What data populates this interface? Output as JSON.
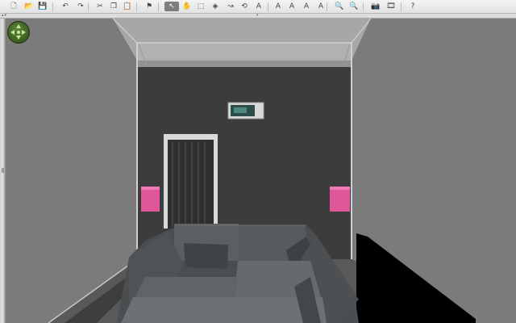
{
  "app": {
    "toolbar": [
      {
        "name": "new-file-icon",
        "glyph": "🗋"
      },
      {
        "name": "open-folder-icon",
        "glyph": "📂"
      },
      {
        "name": "save-icon",
        "glyph": "💾"
      },
      {
        "name": "undo-icon",
        "glyph": "↶"
      },
      {
        "name": "redo-icon",
        "glyph": "↷"
      },
      {
        "name": "cut-icon",
        "glyph": "✂"
      },
      {
        "name": "copy-icon",
        "glyph": "❐"
      },
      {
        "name": "paste-icon",
        "glyph": "📋"
      },
      {
        "name": "add-furniture-icon",
        "glyph": "⚑"
      },
      {
        "name": "select-mode-icon",
        "glyph": "↖",
        "active": true
      },
      {
        "name": "pan-mode-icon",
        "glyph": "✋"
      },
      {
        "name": "create-walls-icon",
        "glyph": "⬚"
      },
      {
        "name": "create-rooms-icon",
        "glyph": "◈"
      },
      {
        "name": "create-polylines-icon",
        "glyph": "↝"
      },
      {
        "name": "create-dimensions-icon",
        "glyph": "⟲"
      },
      {
        "name": "add-text-icon",
        "glyph": "A"
      },
      {
        "name": "increase-text-size-icon",
        "glyph": "A"
      },
      {
        "name": "decrease-text-size-icon",
        "glyph": "A"
      },
      {
        "name": "bold-text-icon",
        "glyph": "A"
      },
      {
        "name": "italic-text-icon",
        "glyph": "A"
      },
      {
        "name": "zoom-in-icon",
        "glyph": "🔍"
      },
      {
        "name": "zoom-out-icon",
        "glyph": "🔍"
      },
      {
        "name": "create-photo-icon",
        "glyph": "📷"
      },
      {
        "name": "create-video-icon",
        "glyph": "🎞"
      },
      {
        "name": "help-icon",
        "glyph": "?"
      }
    ],
    "colors": {
      "toolbar_bg": "#e8e8e8",
      "active_tool": "#7d7d7d",
      "ceiling": "#a9a9a9",
      "back_wall": "#3a3a3a",
      "side_walls": "#7a7a7a",
      "floor": "#585858",
      "speaker_pink": "#e0569a",
      "sofa": "#55595c",
      "door_frame": "#d8d8d8"
    }
  }
}
